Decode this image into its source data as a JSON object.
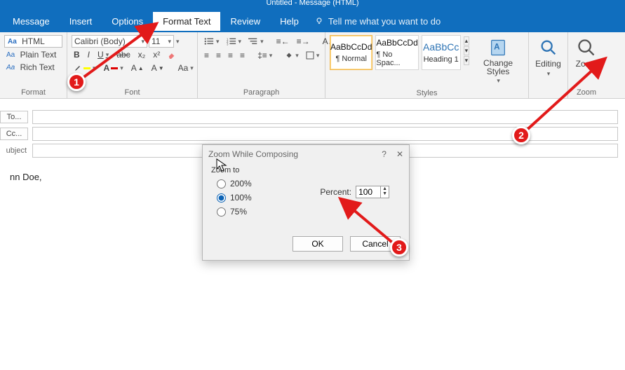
{
  "window": {
    "title": "Untitled - Message (HTML)"
  },
  "menu": {
    "message": "Message",
    "insert": "Insert",
    "options": "Options",
    "format_text": "Format Text",
    "review": "Review",
    "help": "Help",
    "tell_me": "Tell me what you want to do"
  },
  "ribbon": {
    "format": {
      "html_btn": "HTML",
      "plain": "Plain Text",
      "rich": "Rich Text",
      "group": "Format"
    },
    "font": {
      "name": "Calibri (Body)",
      "size": "11",
      "group": "Font"
    },
    "paragraph": {
      "group": "Paragraph"
    },
    "styles": {
      "s1": {
        "preview": "AaBbCcDd",
        "name": "¶ Normal"
      },
      "s2": {
        "preview": "AaBbCcDd",
        "name": "¶ No Spac..."
      },
      "s3": {
        "preview": "AaBbCc",
        "name": "Heading 1"
      },
      "change": "Change Styles",
      "group": "Styles"
    },
    "editing": {
      "label": "Editing"
    },
    "zoom": {
      "label": "Zoom",
      "group": "Zoom"
    }
  },
  "compose": {
    "to": "To...",
    "cc": "Cc...",
    "subject_lbl": "ubject",
    "to_val": "",
    "cc_val": "",
    "subject_val": "",
    "body": "nn Doe,"
  },
  "dialog": {
    "title": "Zoom While Composing",
    "group": "Zoom to",
    "r200": "200%",
    "r100": "100%",
    "r75": "75%",
    "selected": "100",
    "percent_lbl": "Percent:",
    "percent_val": "100",
    "ok": "OK",
    "cancel": "Cancel"
  },
  "callouts": {
    "c1": "1",
    "c2": "2",
    "c3": "3"
  }
}
